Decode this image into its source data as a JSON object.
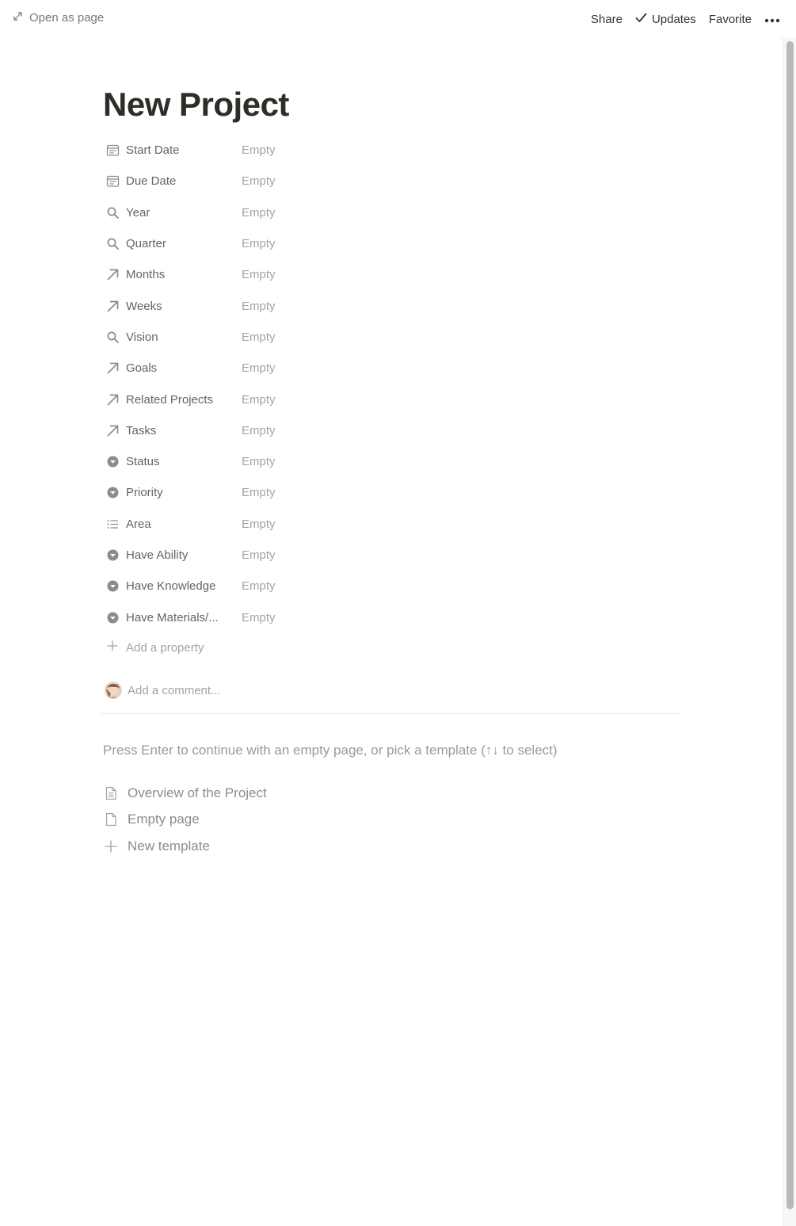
{
  "topbar": {
    "open_as_page": "Open as page",
    "share": "Share",
    "updates": "Updates",
    "favorite": "Favorite"
  },
  "page": {
    "title": "New Project"
  },
  "properties": [
    {
      "label": "Start Date",
      "value": "Empty",
      "icon": "calendar-icon"
    },
    {
      "label": "Due Date",
      "value": "Empty",
      "icon": "calendar-icon"
    },
    {
      "label": "Year",
      "value": "Empty",
      "icon": "search-icon"
    },
    {
      "label": "Quarter",
      "value": "Empty",
      "icon": "search-icon"
    },
    {
      "label": "Months",
      "value": "Empty",
      "icon": "relation-arrow-icon"
    },
    {
      "label": "Weeks",
      "value": "Empty",
      "icon": "relation-arrow-icon"
    },
    {
      "label": "Vision",
      "value": "Empty",
      "icon": "search-icon"
    },
    {
      "label": "Goals",
      "value": "Empty",
      "icon": "relation-arrow-icon"
    },
    {
      "label": "Related Projects",
      "value": "Empty",
      "icon": "relation-arrow-icon"
    },
    {
      "label": "Tasks",
      "value": "Empty",
      "icon": "relation-arrow-icon"
    },
    {
      "label": "Status",
      "value": "Empty",
      "icon": "select-icon"
    },
    {
      "label": "Priority",
      "value": "Empty",
      "icon": "select-icon"
    },
    {
      "label": "Area",
      "value": "Empty",
      "icon": "multi-select-icon"
    },
    {
      "label": "Have Ability",
      "value": "Empty",
      "icon": "select-icon"
    },
    {
      "label": "Have Knowledge",
      "value": "Empty",
      "icon": "select-icon"
    },
    {
      "label": "Have Materials/...",
      "value": "Empty",
      "icon": "select-icon"
    }
  ],
  "add_property": "Add a property",
  "comment": {
    "placeholder": "Add a comment..."
  },
  "hint": "Press Enter to continue with an empty page, or pick a template (↑↓ to select)",
  "templates": [
    {
      "label": "Overview of the Project",
      "icon": "document-text-icon"
    },
    {
      "label": "Empty page",
      "icon": "document-icon"
    },
    {
      "label": "New template",
      "icon": "plus-icon"
    }
  ],
  "colors": {
    "text": "#37352f",
    "muted": "#a4a39f",
    "label": "#66645f"
  }
}
